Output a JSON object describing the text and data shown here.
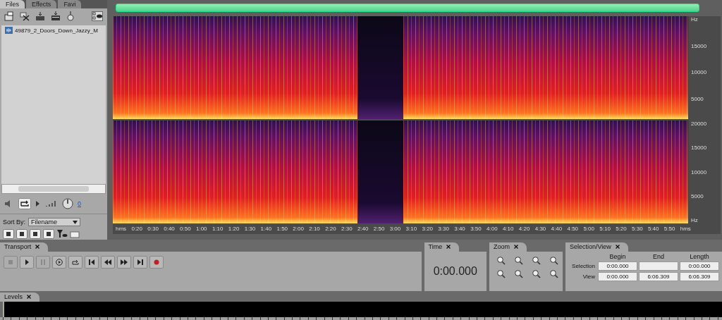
{
  "files_panel": {
    "tabs": [
      {
        "label": "Files",
        "selected": true
      },
      {
        "label": "Effects",
        "selected": false
      },
      {
        "label": "Favi",
        "selected": false
      }
    ],
    "files": [
      "49879_2_Doors_Down_Jazzy_M"
    ],
    "volume_value": "0",
    "sort_by": {
      "label": "Sort By:",
      "value": "Filename"
    }
  },
  "spectrogram": {
    "channels": [
      {
        "freq_labels": [
          "Hz",
          "15000",
          "10000",
          "5000"
        ]
      },
      {
        "freq_labels": [
          "20000",
          "15000",
          "10000",
          "5000",
          "Hz"
        ]
      }
    ],
    "time_labels": [
      "hms",
      "0:20",
      "0:30",
      "0:40",
      "0:50",
      "1:00",
      "1:10",
      "1:20",
      "1:30",
      "1:40",
      "1:50",
      "2:00",
      "2:10",
      "2:20",
      "2:30",
      "2:40",
      "2:50",
      "3:00",
      "3:10",
      "3:20",
      "3:30",
      "3:40",
      "3:50",
      "4:00",
      "4:10",
      "4:20",
      "4:30",
      "4:40",
      "4:50",
      "5:00",
      "5:10",
      "5:20",
      "5:30",
      "5:40",
      "5:50",
      "hms"
    ]
  },
  "transport": {
    "title": "Transport",
    "buttons": [
      {
        "kind": "stop",
        "disabled": true
      },
      {
        "kind": "play",
        "disabled": false
      },
      {
        "kind": "pause",
        "disabled": true
      },
      {
        "kind": "play-from",
        "disabled": false
      },
      {
        "kind": "loop",
        "disabled": false
      },
      {
        "kind": "go-start",
        "disabled": false
      },
      {
        "kind": "rewind",
        "disabled": false
      },
      {
        "kind": "forward",
        "disabled": false
      },
      {
        "kind": "go-end",
        "disabled": false
      },
      {
        "kind": "record",
        "disabled": false
      }
    ]
  },
  "time": {
    "title": "Time",
    "value": "0:00.000"
  },
  "zoom": {
    "title": "Zoom"
  },
  "selection_view": {
    "title": "Selection/View",
    "columns": [
      "Begin",
      "End",
      "Length"
    ],
    "rows": [
      {
        "label": "Selection",
        "begin": "0:00.000",
        "length": "0:00.000"
      },
      {
        "label": "View",
        "begin": "0:00.000",
        "end": "6:06.309",
        "length": "6:06.309"
      }
    ]
  },
  "levels": {
    "title": "Levels"
  }
}
